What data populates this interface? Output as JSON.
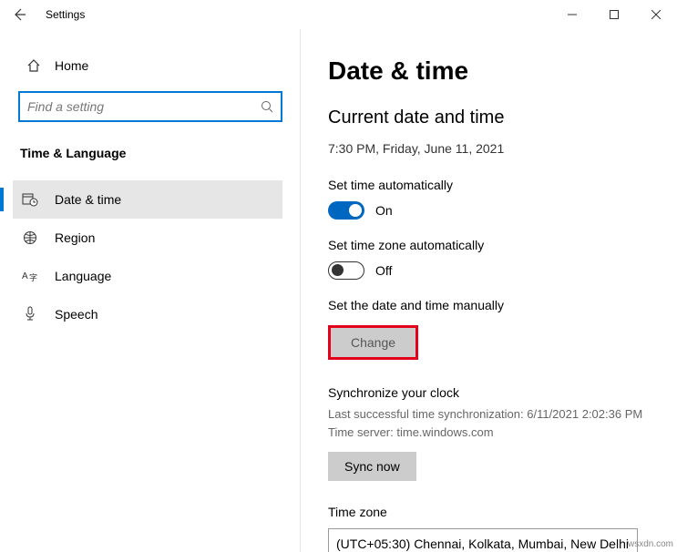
{
  "window": {
    "title": "Settings"
  },
  "sidebar": {
    "home": "Home",
    "search_placeholder": "Find a setting",
    "section": "Time & Language",
    "items": [
      {
        "label": "Date & time"
      },
      {
        "label": "Region"
      },
      {
        "label": "Language"
      },
      {
        "label": "Speech"
      }
    ]
  },
  "content": {
    "heading": "Date & time",
    "subhead": "Current date and time",
    "current": "7:30 PM, Friday, June 11, 2021",
    "set_time_auto_label": "Set time automatically",
    "set_time_auto_state": "On",
    "set_tz_auto_label": "Set time zone automatically",
    "set_tz_auto_state": "Off",
    "manual_label": "Set the date and time manually",
    "change_btn": "Change",
    "sync_heading": "Synchronize your clock",
    "sync_last_label": "Last successful time synchronization:",
    "sync_last_value": "6/11/2021 2:02:36 PM",
    "sync_server_label": "Time server:",
    "sync_server_value": "time.windows.com",
    "sync_btn": "Sync now",
    "tz_label": "Time zone",
    "tz_value": "(UTC+05:30) Chennai, Kolkata, Mumbai, New Delhi"
  },
  "watermark": "wsxdn.com"
}
